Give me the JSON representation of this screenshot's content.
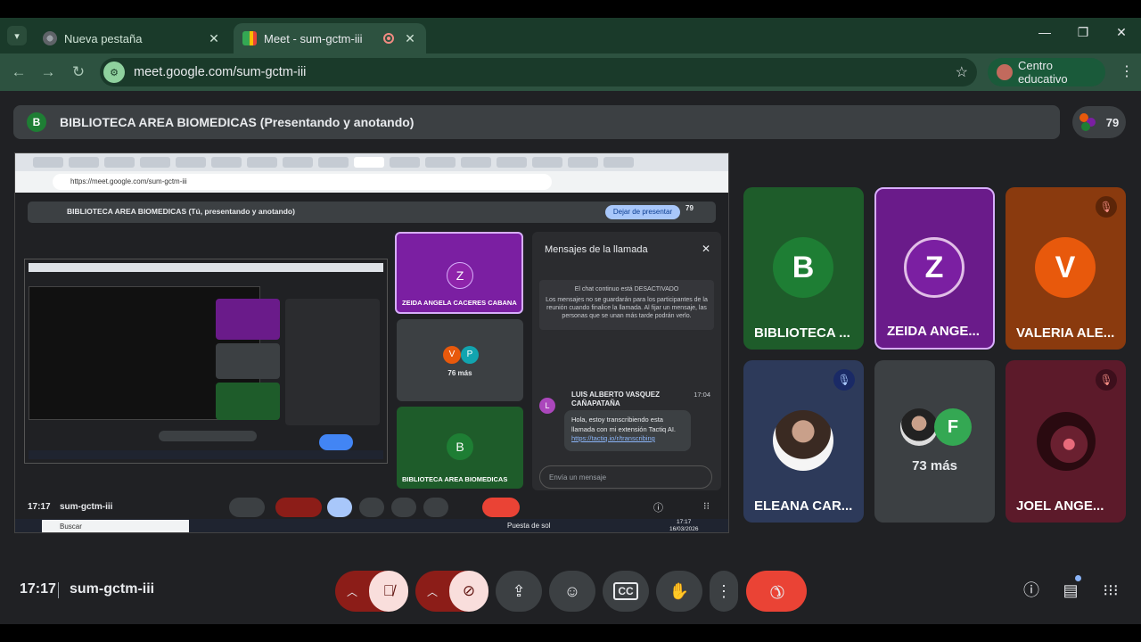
{
  "browser": {
    "tabs": [
      {
        "title": "Nueva pestaña",
        "active": false
      },
      {
        "title": "Meet - sum-gctm-iii",
        "active": true
      }
    ],
    "url": "meet.google.com/sum-gctm-iii",
    "profile_label": "Centro educativo"
  },
  "meet": {
    "presenter_badge": "B",
    "presenter_title": "BIBLIOTECA AREA BIOMEDICAS (Presentando y anotando)",
    "participant_count": "79",
    "time": "17:17",
    "meeting_code": "sum-gctm-iii"
  },
  "shared_screen": {
    "url": "https://meet.google.com/sum-gctm-iii",
    "presenter_title": "BIBLIOTECA AREA BIOMEDICAS (Tú, presentando y anotando)",
    "stop_presenting": "Dejar de presentar",
    "participant_count": "79",
    "tile_z_initial": "Z",
    "tile_z_name": "ZEIDA ANGELA CACERES CABANA",
    "tile_more_initials": [
      "V",
      "P"
    ],
    "tile_more_label": "76 más",
    "tile_b_initial": "B",
    "tile_b_name": "BIBLIOTECA AREA BIOMEDICAS",
    "chat_title": "Mensajes de la llamada",
    "chat_note_title": "El chat continuo está DESACTIVADO",
    "chat_note_body": "Los mensajes no se guardarán para los participantes de la reunión cuando finalice la llamada. Al fijar un mensaje, las personas que se unan más tarde podrán verlo.",
    "chat_sender_initial": "L",
    "chat_sender": "LUIS ALBERTO VASQUEZ CAÑAPATAÑA",
    "chat_time": "17:04",
    "chat_message": "Hola, estoy transcribiendo esta llamada con mi extensión Tactiq AI.",
    "chat_link": "https://tactiq.io/r/transcribing",
    "chat_placeholder": "Envía un mensaje",
    "time": "17:17",
    "code": "sum-gctm-iii",
    "taskbar_search": "Buscar",
    "weather": "Puesta de sol",
    "clock_time": "17:17",
    "clock_date": "16/03/2026"
  },
  "tiles": [
    {
      "initial": "B",
      "name": "BIBLIOTECA ...",
      "color": "#1e5c2a",
      "avatar_color": "#1e7e34",
      "muted": false
    },
    {
      "initial": "Z",
      "name": "ZEIDA ANGE...",
      "color": "#6a1b8a",
      "avatar_color": "#7b1fa2",
      "muted": false,
      "speaking": true
    },
    {
      "initial": "V",
      "name": "VALERIA ALE...",
      "color": "#8a3a0e",
      "avatar_color": "#e8590c",
      "muted": true
    },
    {
      "initial": "",
      "name": "ELEANA CAR...",
      "color": "#2d3a5a",
      "muted": true,
      "photo": true
    },
    {
      "initial": "F",
      "name": "",
      "more_label": "73 más",
      "color": "#3c4043",
      "avatar_color": "#34a853"
    },
    {
      "initial": "",
      "name": "JOEL ANGE...",
      "color": "#5c1a2a",
      "muted": true,
      "photo": true
    }
  ],
  "icons": {
    "mic": "mic-off-icon",
    "camera": "camera-off-icon",
    "present": "present-icon",
    "emoji": "emoji-icon",
    "captions": "captions-icon",
    "hand": "raise-hand-icon",
    "more": "more-options-icon",
    "end": "end-call-icon",
    "info": "info-icon",
    "chat": "chat-icon",
    "activities": "activities-icon"
  },
  "colors": {
    "browser_frame": "#1a3a2a",
    "end_call": "#ea4335",
    "muted_button": "#f9dedc"
  }
}
